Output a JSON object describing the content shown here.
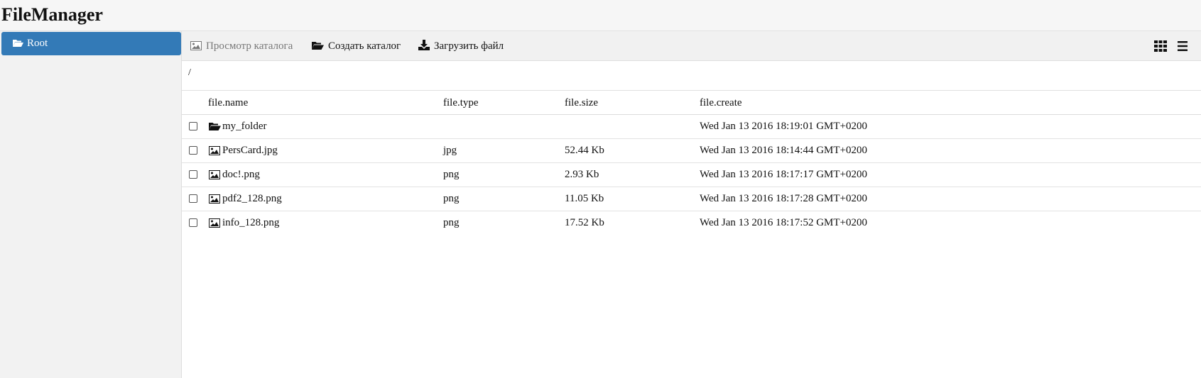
{
  "app": {
    "title": "FileManager"
  },
  "sidebar": {
    "root_label": "Root"
  },
  "toolbar": {
    "view_label": "Просмотр каталога",
    "create_label": "Создать каталог",
    "upload_label": "Загрузить файл"
  },
  "path": "/",
  "table": {
    "columns": {
      "name": "file.name",
      "type": "file.type",
      "size": "file.size",
      "create": "file.create"
    },
    "rows": [
      {
        "icon": "folder-icon",
        "name": "my_folder",
        "type": "",
        "size": "",
        "create": "Wed Jan 13 2016 18:19:01 GMT+0200"
      },
      {
        "icon": "image-icon",
        "name": "PersCard.jpg",
        "type": "jpg",
        "size": "52.44 Kb",
        "create": "Wed Jan 13 2016 18:14:44 GMT+0200"
      },
      {
        "icon": "image-icon",
        "name": "doc!.png",
        "type": "png",
        "size": "2.93 Kb",
        "create": "Wed Jan 13 2016 18:17:17 GMT+0200"
      },
      {
        "icon": "image-icon",
        "name": "pdf2_128.png",
        "type": "png",
        "size": "11.05 Kb",
        "create": "Wed Jan 13 2016 18:17:28 GMT+0200"
      },
      {
        "icon": "image-icon",
        "name": "info_128.png",
        "type": "png",
        "size": "17.52 Kb",
        "create": "Wed Jan 13 2016 18:17:52 GMT+0200"
      }
    ]
  },
  "colors": {
    "selected_bg": "#337ab7",
    "header_bg": "#f6f6f6",
    "toolbar_bg": "#f1f1f1",
    "sidebar_bg": "#f2f2f2"
  }
}
